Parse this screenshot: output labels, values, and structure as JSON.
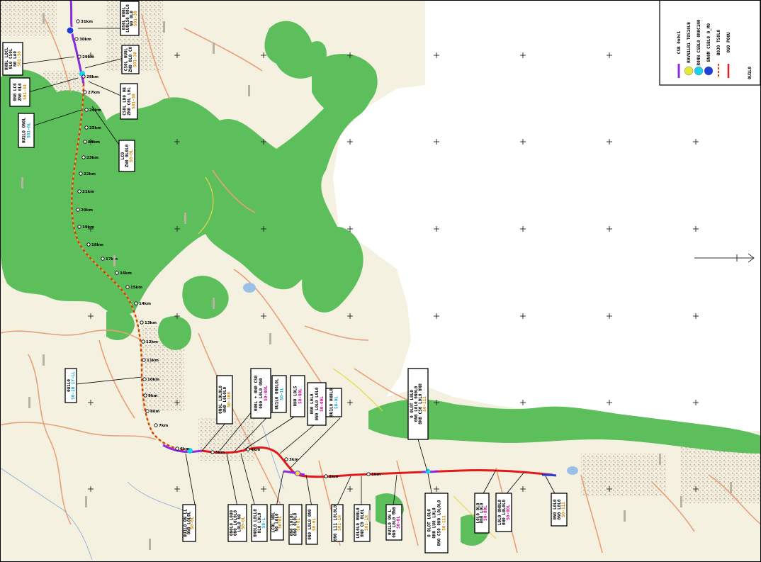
{
  "legend": {
    "entries": [
      {
        "label": "CSB 0n0c1",
        "symbol": "purple-bar",
        "color": "#8a2be2"
      },
      {
        "label": "R0VN1LB1 TOS10LB",
        "symbol": "yellow-circle",
        "color": "#e5e83a"
      },
      {
        "label": "R0NN CSBL0 0N0C1N0",
        "symbol": "cyan-circle",
        "color": "#1ad1f0"
      },
      {
        "label": "BN0M CSBL0 0_M0",
        "symbol": "blue-circle",
        "color": "#1f3fd6"
      },
      {
        "label": "B0J0 TS0L0",
        "symbol": "dashed-line",
        "color": "#d32f2f"
      },
      {
        "label": "0U0 P00U",
        "symbol": "red-line",
        "color": "#e02020"
      }
    ],
    "footer": "0U1L0"
  },
  "route": {
    "km_markers": [
      "31km",
      "30km",
      "29km",
      "28km",
      "27km",
      "26km",
      "25km",
      "24km",
      "23km",
      "22km",
      "21km",
      "20km",
      "19km",
      "18km",
      "17km",
      "16km",
      "15km",
      "14km",
      "13km",
      "12km",
      "11km",
      "10km",
      "9km",
      "8km",
      "7km",
      "6km",
      "5km",
      "4km",
      "3km",
      "2km",
      "1km"
    ]
  },
  "callouts": [
    {
      "name": "callout-top-left-1",
      "lines": [
        "0N0L L0CL",
        "0L0 CS0L",
        "N0 LA0"
      ],
      "code": "S01-30",
      "code_color": "orange"
    },
    {
      "name": "callout-top-left-2",
      "lines": [
        "0N0 LC0",
        "ZN0 0L0"
      ],
      "code": "S01-34",
      "code_color": "orange"
    },
    {
      "name": "callout-top-left-3",
      "lines": [
        "0U1L0 0N0L"
      ],
      "code": "S01-0L",
      "code_color": "cyan"
    },
    {
      "name": "callout-top-right-1",
      "lines": [
        "0S0L 0N0L",
        "LU0LS0 00L0",
        "N0 0L0"
      ],
      "code": "S01-30",
      "code_color": "orange"
    },
    {
      "name": "callout-top-right-2",
      "lines": [
        "CS0L 0U0L",
        "ZN0 0L0 C0"
      ],
      "code": "S01-30",
      "code_color": "orange"
    },
    {
      "name": "callout-top-right-3",
      "lines": [
        "CS0L LN0 0B",
        "ZN0 C0L L0L"
      ],
      "code": "S01-30",
      "code_color": "orange"
    },
    {
      "name": "callout-mid-right",
      "lines": [
        "LC0",
        "ZN0 0L0L0"
      ],
      "code": "S0-0L",
      "code_color": "orange"
    },
    {
      "name": "callout-mid-left",
      "lines": [
        "0U1L0"
      ],
      "code": "S0-1N 1Y-LL",
      "code_color": "cyan"
    },
    {
      "name": "callout-bottom-a",
      "lines": [
        "0U1L0 0N_LL",
        "0N0 L0L0L"
      ],
      "code": "S0-0L",
      "code_color": "orange"
    },
    {
      "name": "callout-bottom-b",
      "lines": [
        "0N0L0 L0U0",
        "0N0 L0L0L0",
        "L0L0 N0"
      ],
      "code": "S0-0L",
      "code_color": "orange"
    },
    {
      "name": "callout-bottom-c",
      "lines": [
        "0N0L0 L0LL0",
        "0L0 L0L0"
      ],
      "code": "S0-L",
      "code_color": "cyan"
    },
    {
      "name": "callout-bottom-d",
      "lines": [
        "LC0L N0L",
        "N0 L0L0"
      ],
      "code": "S0-0L",
      "code_color": "orange"
    },
    {
      "name": "callout-bottom-e",
      "lines": [
        "0N0 L0L0L",
        "0N0 0L0L0"
      ],
      "code": "S0-0L",
      "code_color": "orange"
    },
    {
      "name": "callout-bottom-f",
      "lines": [
        "0N0 L0L0 0N0"
      ],
      "code": "S0-0L",
      "code_color": "orange"
    },
    {
      "name": "callout-bottom-g",
      "lines": [
        "0N0 L11 L0L0L0"
      ],
      "code": "S01-1N",
      "code_color": "orange"
    },
    {
      "name": "callout-bottom-h",
      "lines": [
        "L0L0L0 0N0L0",
        "0N0 C0 0L0L"
      ],
      "code": "S01-1N",
      "code_color": "orange"
    },
    {
      "name": "callout-bottom-i",
      "lines": [
        "0U1L0 0N_L",
        "0N0 L0L0 0N0"
      ],
      "code": "S0-0L",
      "code_color": "magenta"
    },
    {
      "name": "callout-bottom-j",
      "lines": [
        "0 0L0T L0L0",
        "0N0 LU0 L0L0",
        "0N0 CS0 0N0 L0L0L0"
      ],
      "code": "S0-111",
      "code_color": "orange"
    },
    {
      "name": "callout-bottom-k",
      "lines": [
        "L0L0 0L0",
        "0N0 L0L0"
      ],
      "code": "S0-00L",
      "code_color": "magenta"
    },
    {
      "name": "callout-bottom-l",
      "lines": [
        "L0L0 0N0L0",
        "0N0 L0L0L0"
      ],
      "code": "S0-00L",
      "code_color": "magenta"
    },
    {
      "name": "callout-bottom-m",
      "lines": [
        "0N0 L0L0",
        "0N0 L0L0"
      ],
      "code": "S0-111",
      "code_color": "orange"
    },
    {
      "name": "callout-upper-a",
      "lines": [
        "0N0L L0L0L0",
        "0N0 L0L0L0"
      ],
      "code": "S0-100",
      "code_color": "orange"
    },
    {
      "name": "callout-upper-b",
      "lines": [
        "0N0L + 0N0 CS0",
        "0N0 L0L0 0N0"
      ],
      "code": "S0-00L",
      "code_color": "magenta"
    },
    {
      "name": "callout-upper-c",
      "lines": [
        "0U1L0 0N0L0L"
      ],
      "code": "S0-1L",
      "code_color": "cyan"
    },
    {
      "name": "callout-upper-d",
      "lines": [
        "0N0 L0LS"
      ],
      "code": "S0-00L",
      "code_color": "magenta"
    },
    {
      "name": "callout-upper-e",
      "lines": [
        "0N0 L0L0",
        "0N0 L0L0 L0L0"
      ],
      "code": "S0-00L",
      "code_color": "magenta"
    },
    {
      "name": "callout-upper-f",
      "lines": [
        "0U1L0 0N0L0"
      ],
      "code": "S0-0L",
      "code_color": "cyan"
    },
    {
      "name": "callout-upper-g",
      "lines": [
        "0 0L0T L0L0",
        "0N0 L0L0 0N0L0",
        "0N0 CS0 L0L0 0N0"
      ],
      "code": "S0-111",
      "code_color": "orange"
    }
  ],
  "colors": {
    "forest": "#5cbf5c",
    "land": "#f5f1e1",
    "road": "#e8a07a",
    "route_red": "#e31a1c",
    "route_purple": "#8a2be2"
  }
}
